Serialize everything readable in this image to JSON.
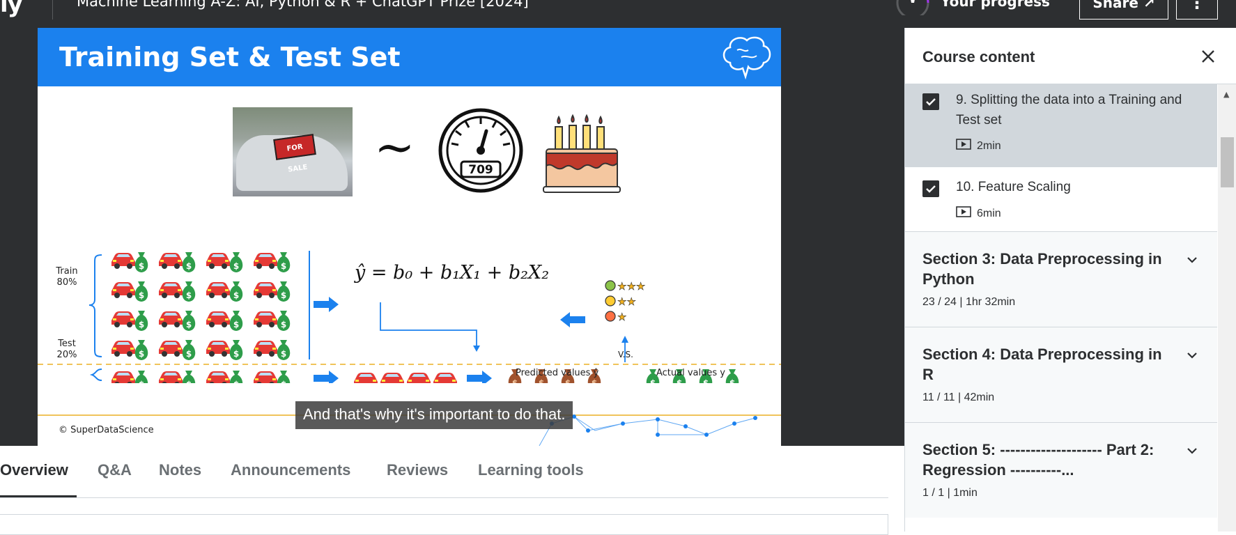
{
  "header": {
    "logo": "ly",
    "course_title": "Machine Learning A-Z: AI, Python & R + ChatGPT Prize [2024]",
    "progress_label": "Your progress",
    "share_label": "Share ↗",
    "more_label": "⋮"
  },
  "slide": {
    "title": "Training Set & Test Set",
    "tilde": "~",
    "gauge_value": "709",
    "sale_sign": "FOR SALE",
    "train_label": "Train\n80%",
    "test_label": "Test\n20%",
    "equation": "ŷ = b₀ + b₁X₁ + b₂X₂",
    "predicted_label": "Predicted values ŷ",
    "vs_label": "V.S.",
    "actual_label": "Actual values y",
    "copyright": "© SuperDataScience",
    "caption": "And that's why it's important to do that."
  },
  "tabs": [
    {
      "label": "Overview",
      "active": true
    },
    {
      "label": "Q&A"
    },
    {
      "label": "Notes"
    },
    {
      "label": "Announcements"
    },
    {
      "label": "Reviews"
    },
    {
      "label": "Learning tools"
    }
  ],
  "sidebar": {
    "title": "Course content",
    "lectures": [
      {
        "title": "9. Splitting the data into a Training and Test set",
        "duration": "2min",
        "checked": true,
        "active": true
      },
      {
        "title": "10. Feature Scaling",
        "duration": "6min",
        "checked": true,
        "active": false
      }
    ],
    "sections": [
      {
        "title": "Section 3: Data Preprocessing in Python",
        "meta": "23 / 24 | 1hr 32min"
      },
      {
        "title": "Section 4: Data Preprocessing in R",
        "meta": "11 / 11 | 42min"
      },
      {
        "title": "Section 5: -------------------- Part 2: Regression ----------...",
        "meta": "1 / 1 | 1min"
      }
    ]
  },
  "colors": {
    "header_bg": "#2d2f31",
    "slide_blue": "#1b81ee",
    "active_lecture_bg": "#d1d7dc",
    "car_red": "#e53935",
    "money_green": "#2e9d4a",
    "money_brown": "#a0522d"
  }
}
